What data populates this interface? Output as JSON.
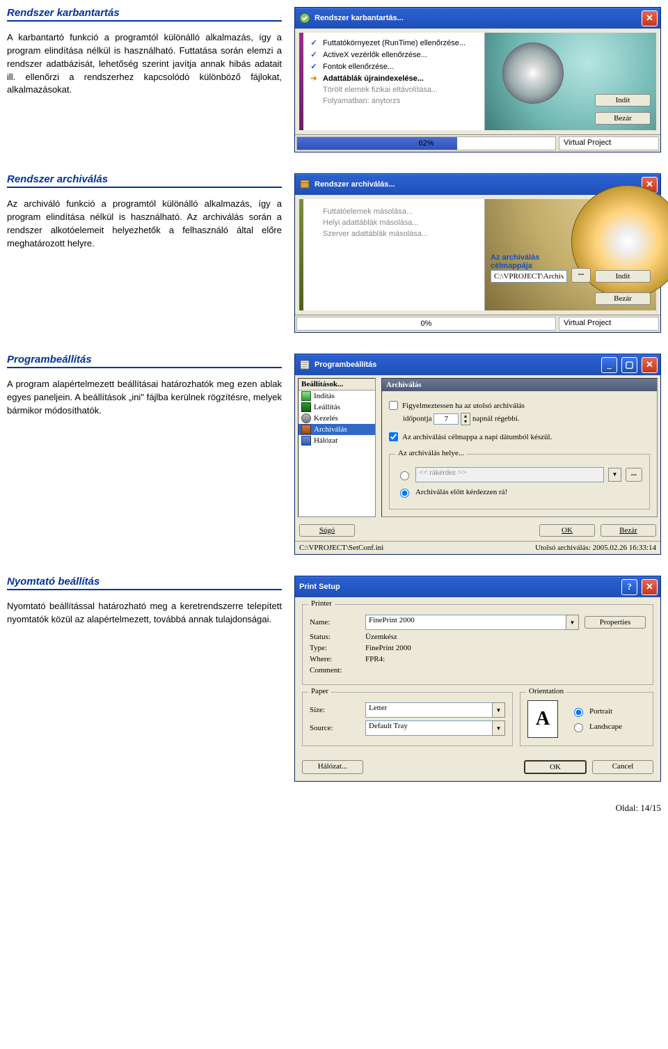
{
  "page_footer": "Oldal: 14/15",
  "s1": {
    "heading": "Rendszer karbantartás",
    "body": "A karbantartó funkció a programtól különálló alkalmazás, így a program elindítása nélkül is használható. Futtatása során elemzi a rendszer adatbázisát, lehetőség szerint javítja annak hibás adatait ill. ellenőrzi a rendszerhez kapcsolódó különböző fájlokat, alkalmazásokat.",
    "win_title": "Rendszer karbantartás...",
    "items": {
      "a": "Futtatókörnyezet (RunTime) ellenőrzése...",
      "b": "ActiveX vezérlők ellenőrzése...",
      "c": "Fontok ellenőrzése...",
      "d": "Adattáblák újraindexelése...",
      "e": "Törölt elemek fizikai eltávolítása...",
      "f": "Folyamatban: anytorzs"
    },
    "btn_start": "Indít",
    "btn_close": "Bezár",
    "pct": "62%",
    "status": "Virtual Project"
  },
  "s2": {
    "heading": "Rendszer archiválás",
    "body": "Az archiváló funkció a programtól különálló alkalmazás, így a program elindítása nélkül is használható. Az archiválás során a rendszer alkotóelemeit helyezhetők a felhasználó által előre meghatározott helyre.",
    "win_title": "Rendszer archiválás...",
    "items": {
      "a": "Futtatóelemek másolása...",
      "b": "Helyi adattáblák másolása...",
      "c": "Szerver adattáblák másolása..."
    },
    "path_label": "Az archiválás célmappája",
    "path_value": "C:\\VPROJECT\\Archiv\\",
    "btn_start": "Indít",
    "btn_close": "Bezár",
    "pct": "0%",
    "status": "Virtual Project"
  },
  "s3": {
    "heading": "Programbeállítás",
    "body": "A program alapértelmezett beállításai határozhatók meg ezen ablak egyes paneljein. A beállítások „ini\" fájlba kerülnek rögzítésre, melyek bármikor módosíthatók.",
    "win_title": "Programbeállítás",
    "tree_head": "Beállítások...",
    "tree": {
      "a": "Indítás",
      "b": "Leállítás",
      "c": "Kezelés",
      "d": "Archiválás",
      "e": "Hálózat"
    },
    "panel_title": "Archiválás",
    "chk_warn1": "Figyelmeztessen ha az utolsó archiválás",
    "chk_warn2_a": "időpontja",
    "chk_warn2_val": "7",
    "chk_warn2_b": "napnál régebbi.",
    "chk_date": "Az archiválási célmappa a napi dátumból készül.",
    "grp_title": "Az archiválás helye...",
    "opt1_placeholder": "<< rákérdez >>",
    "opt2": "Archiválás előtt kérdezzen rá!",
    "btn_help": "Súgó",
    "btn_ok": "OK",
    "btn_close": "Bezár",
    "status_left": "C:\\VPROJECT\\SetConf.ini",
    "status_right": "Utolsó archiválás: 2005.02.26 16:33:14"
  },
  "s4": {
    "heading": "Nyomtató beállítás",
    "body": "Nyomtató beállítással határozható meg a keretrendszerre telepített nyomtatók közül az alapértelmezett, továbbá annak tulajdonságai.",
    "win_title": "Print Setup",
    "printer": {
      "legend": "Printer",
      "name_k": "Name:",
      "name_v": "FinePrint 2000",
      "btn_props": "Properties",
      "status_k": "Status:",
      "status_v": "Üzemkész",
      "type_k": "Type:",
      "type_v": "FinePrint 2000",
      "where_k": "Where:",
      "where_v": "FPR4:",
      "comment_k": "Comment:"
    },
    "paper": {
      "legend": "Paper",
      "size_k": "Size:",
      "size_v": "Letter",
      "source_k": "Source:",
      "source_v": "Default Tray"
    },
    "orient": {
      "legend": "Orientation",
      "portrait": "Portrait",
      "landscape": "Landscape",
      "preview": "A"
    },
    "btn_net": "Hálózat...",
    "btn_ok": "OK",
    "btn_cancel": "Cancel"
  }
}
